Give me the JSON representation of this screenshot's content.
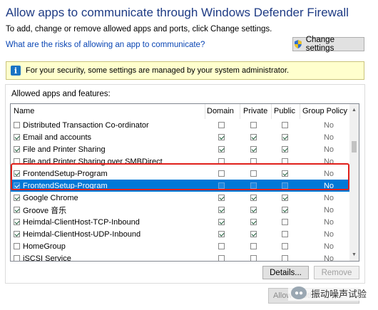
{
  "window": {
    "title": "Allow apps to communicate through Windows Defender Firewall",
    "subtitle": "To add, change or remove allowed apps and ports, click Change settings.",
    "risk_link": "What are the risks of allowing an app to communicate?",
    "change_settings_label": "Change settings"
  },
  "info_bar": {
    "text": "For your security, some settings are managed by your system administrator."
  },
  "list": {
    "group_label": "Allowed apps and features:",
    "columns": [
      "Name",
      "Domain",
      "Private",
      "Public",
      "Group Policy"
    ],
    "rows": [
      {
        "name": "Distributed Transaction Co-ordinator",
        "enabled": false,
        "domain": false,
        "private": false,
        "public": false,
        "group_policy": "No",
        "selected": false
      },
      {
        "name": "Email and accounts",
        "enabled": true,
        "domain": true,
        "private": true,
        "public": true,
        "group_policy": "No",
        "selected": false
      },
      {
        "name": "File and Printer Sharing",
        "enabled": true,
        "domain": true,
        "private": true,
        "public": true,
        "group_policy": "No",
        "selected": false
      },
      {
        "name": "File and Printer Sharing over SMBDirect",
        "enabled": false,
        "domain": false,
        "private": false,
        "public": false,
        "group_policy": "No",
        "selected": false
      },
      {
        "name": "FrontendSetup-Program",
        "enabled": true,
        "domain": false,
        "private": false,
        "public": true,
        "group_policy": "No",
        "selected": false
      },
      {
        "name": "FrontendSetup-Program",
        "enabled": true,
        "domain": false,
        "private": false,
        "public": false,
        "group_policy": "No",
        "selected": true
      },
      {
        "name": "Google Chrome",
        "enabled": true,
        "domain": true,
        "private": true,
        "public": true,
        "group_policy": "No",
        "selected": false
      },
      {
        "name": "Groove 音乐",
        "enabled": true,
        "domain": true,
        "private": true,
        "public": true,
        "group_policy": "No",
        "selected": false
      },
      {
        "name": "Heimdal-ClientHost-TCP-Inbound",
        "enabled": true,
        "domain": true,
        "private": true,
        "public": false,
        "group_policy": "No",
        "selected": false
      },
      {
        "name": "Heimdal-ClientHost-UDP-Inbound",
        "enabled": true,
        "domain": true,
        "private": true,
        "public": false,
        "group_policy": "No",
        "selected": false
      },
      {
        "name": "HomeGroup",
        "enabled": false,
        "domain": false,
        "private": false,
        "public": false,
        "group_policy": "No",
        "selected": false
      },
      {
        "name": "iSCSI Service",
        "enabled": false,
        "domain": false,
        "private": false,
        "public": false,
        "group_policy": "No",
        "selected": false
      }
    ]
  },
  "buttons": {
    "details": "Details...",
    "remove": "Remove",
    "allow_another": "Allow another app..."
  },
  "watermark": {
    "text": "振动噪声试验"
  },
  "colors": {
    "title": "#1e3b84",
    "link": "#0a46b4",
    "selection": "#0078d7",
    "highlight_box": "#e0201b",
    "info_bar": "#ffffcd"
  }
}
